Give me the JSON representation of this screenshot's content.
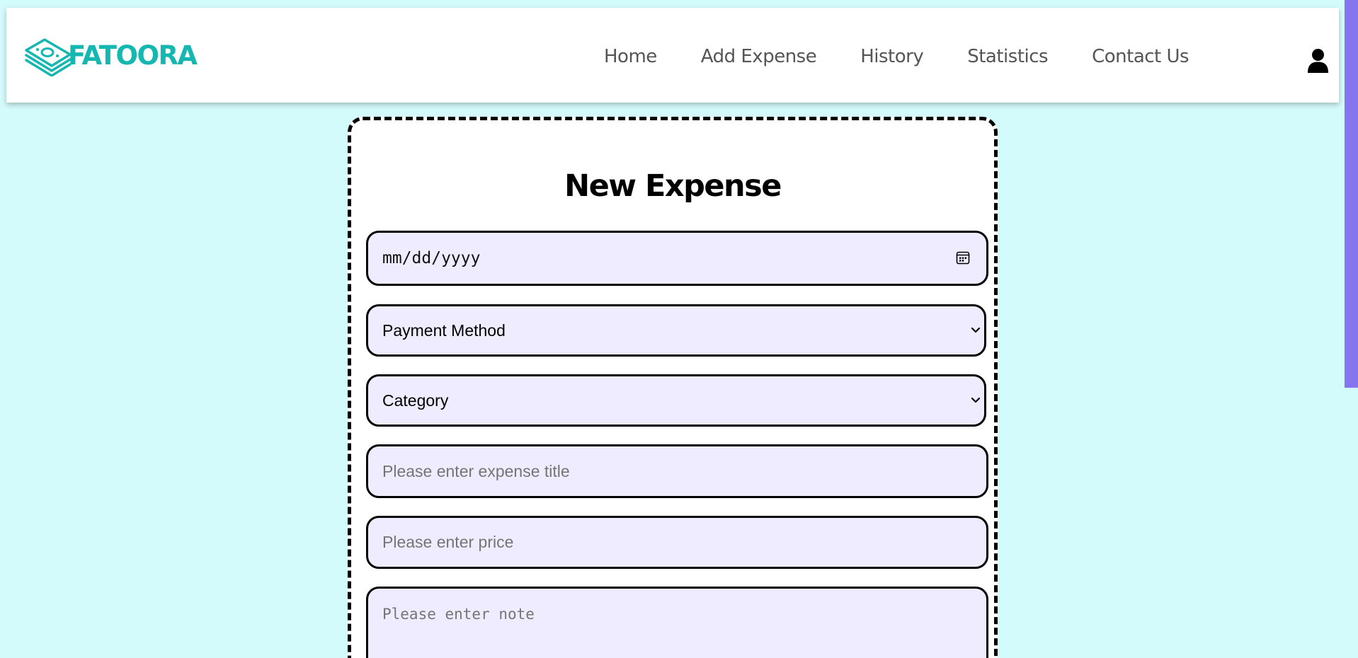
{
  "brand": {
    "name": "FATOORA",
    "color": "#15b7b1"
  },
  "nav": {
    "items": [
      {
        "label": "Home"
      },
      {
        "label": "Add Expense"
      },
      {
        "label": "History"
      },
      {
        "label": "Statistics"
      },
      {
        "label": "Contact Us"
      }
    ],
    "user_icon": "user-icon"
  },
  "form": {
    "title": "New Expense",
    "date_placeholder": "mm/dd/yyyy",
    "payment_method": {
      "selected": "Payment Method"
    },
    "category": {
      "selected": "Category"
    },
    "title_placeholder": "Please enter expense title",
    "price_placeholder": "Please enter price",
    "note_placeholder": "Please enter note"
  },
  "colors": {
    "background": "#d4fbfb",
    "field_fill": "#f0ecff",
    "accent": "#8575ee"
  }
}
